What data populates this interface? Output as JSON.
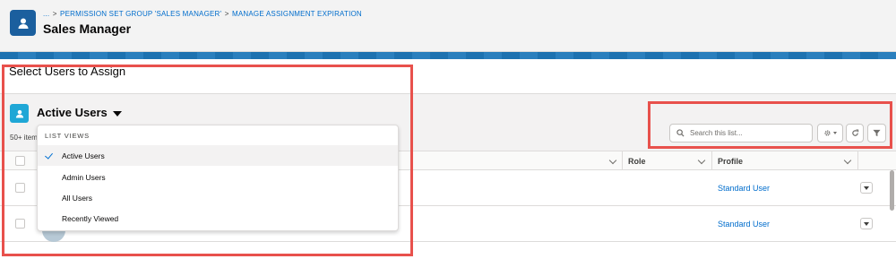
{
  "header": {
    "breadcrumb": [
      "...",
      "PERMISSION SET GROUP 'SALES MANAGER'",
      "MANAGE ASSIGNMENT EXPIRATION"
    ],
    "breadcrumb_separator": ">",
    "title": "Sales Manager",
    "icon": "permission-set-group-icon"
  },
  "section_heading": "Select Users to Assign",
  "list_view": {
    "title": "Active Users",
    "icon": "user-icon",
    "item_count": "50+ items",
    "search_placeholder": "Search this list..."
  },
  "toolbar": {
    "settings_icon": "gear-icon",
    "refresh_icon": "refresh-icon",
    "filter_icon": "filter-icon"
  },
  "dropdown": {
    "heading": "LIST VIEWS",
    "items": [
      {
        "label": "Active Users",
        "selected": true
      },
      {
        "label": "Admin Users",
        "selected": false
      },
      {
        "label": "All Users",
        "selected": false
      },
      {
        "label": "Recently Viewed",
        "selected": false
      }
    ]
  },
  "table": {
    "columns": [
      "",
      "Role",
      "Profile"
    ],
    "rows": [
      {
        "role": "",
        "profile": "Standard User"
      },
      {
        "role": "",
        "profile": "Standard User"
      }
    ]
  },
  "colors": {
    "annotation": "#e8514c",
    "link": "#006dcc",
    "brand": "#1b5f9e",
    "list_icon": "#1fa7d6"
  }
}
